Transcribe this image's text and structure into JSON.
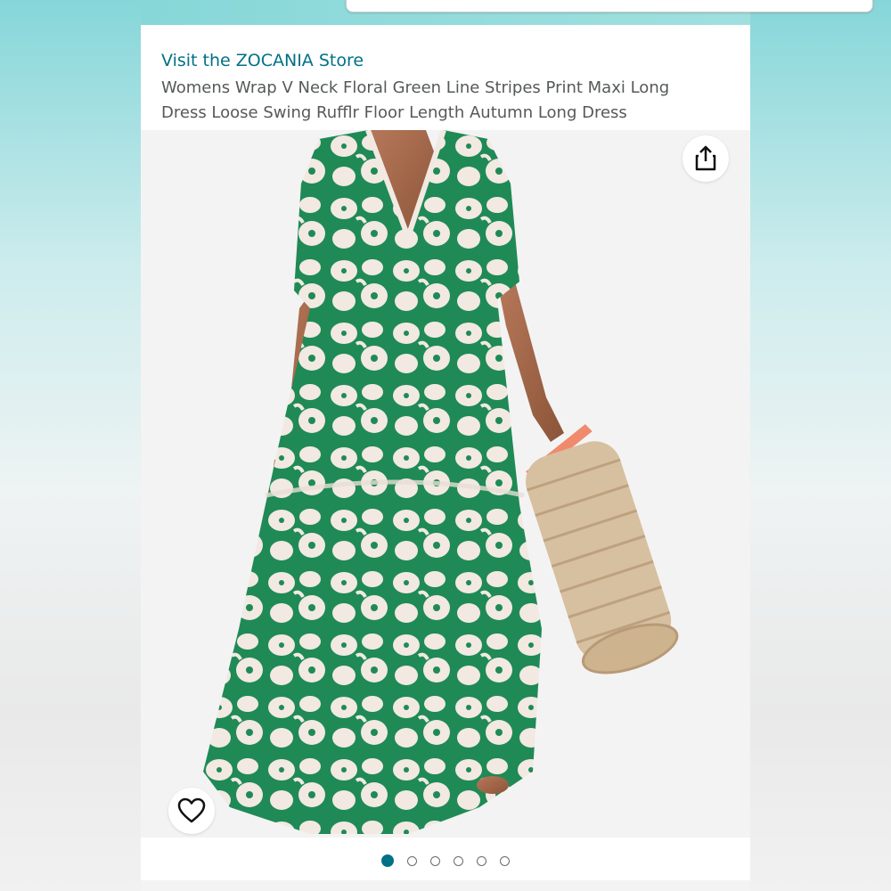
{
  "product": {
    "store_link": "Visit the ZOCANIA Store",
    "title": "Womens Wrap V Neck Floral Green Line Stripes Print Maxi Long Dress Loose Swing Rufflr Floor Length Autumn Long Dress"
  },
  "gallery": {
    "image_count": 6,
    "active_index": 0
  },
  "icons": {
    "share": "share-icon",
    "favorite": "heart-icon"
  },
  "colors": {
    "link": "#007185",
    "title_text": "#565959",
    "dress_green": "#1f8a55",
    "top_accent": "#87d7d8"
  }
}
